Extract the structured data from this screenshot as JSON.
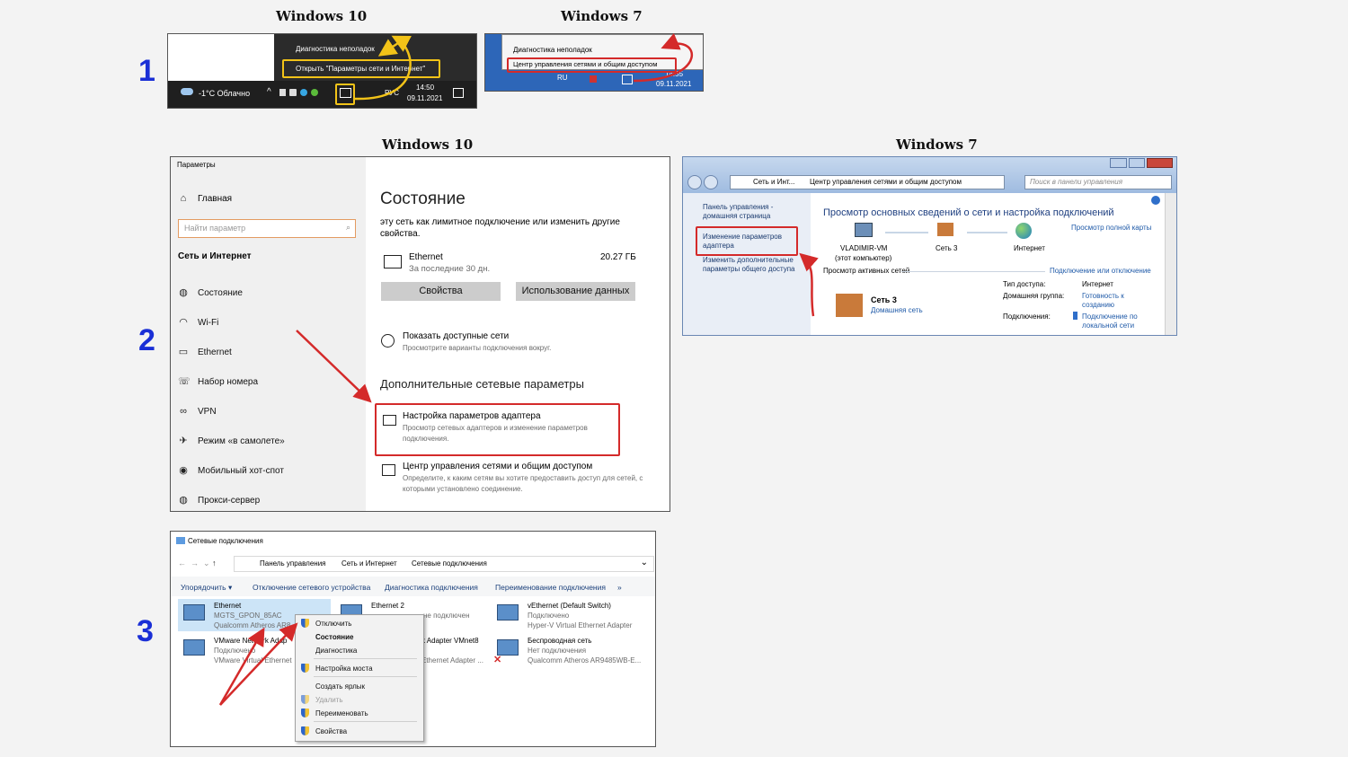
{
  "headings": {
    "row1_win10": "Windows 10",
    "row1_win7": "Windows 7",
    "row2_win10": "Windows 10",
    "row2_win7": "Windows 7"
  },
  "steps": [
    "1",
    "2",
    "3"
  ],
  "colors": {
    "highlight_red": "#d42a2a",
    "highlight_yellow": "#f2c318",
    "step_blue": "#1a2fd6"
  },
  "tray10": {
    "menu_item_1": "Диагностика неполадок",
    "menu_item_2": "Открыть \"Параметры сети и Интернет\"",
    "weather": "-1°C Облачно",
    "lang": "РУС",
    "time": "14:50",
    "date": "09.11.2021"
  },
  "tray7": {
    "menu_item_1": "Диагностика неполадок",
    "menu_item_2": "Центр управления сетями и общим доступом",
    "lang": "RU",
    "time": "14:55",
    "date": "09.11.2021"
  },
  "settings10": {
    "window_title": "Параметры",
    "home": "Главная",
    "search_placeholder": "Найти параметр",
    "section": "Сеть и Интернет",
    "nav": [
      "Состояние",
      "Wi-Fi",
      "Ethernet",
      "Набор номера",
      "VPN",
      "Режим «в самолете»",
      "Мобильный хот-спот",
      "Прокси-сервер"
    ],
    "page_title": "Состояние",
    "intro": "эту сеть как лимитное подключение или изменить другие свойства.",
    "adapter_name": "Ethernet",
    "adapter_sub": "За последние 30 дн.",
    "adapter_usage": "20.27 ГБ",
    "btn_props": "Свойства",
    "btn_usage": "Использование данных",
    "show_networks": "Показать доступные сети",
    "show_networks_sub": "Просмотрите варианты подключения вокруг.",
    "advanced_title": "Дополнительные сетевые параметры",
    "adapter_settings": "Настройка параметров адаптера",
    "adapter_settings_sub": "Просмотр сетевых адаптеров и изменение параметров подключения.",
    "net_center": "Центр управления сетями и общим доступом",
    "net_center_sub": "Определите, к каким сетям вы хотите предоставить доступ для сетей, с которыми установлено соединение."
  },
  "control7": {
    "breadcrumb": [
      "Сеть и Инт...",
      "Центр управления сетями и общим доступом"
    ],
    "search_placeholder": "Поиск в панели управления",
    "left_home": "Панель управления - домашняя страница",
    "left_adapter": "Изменение параметров адаптера",
    "left_sharing": "Изменить дополнительные параметры общего доступа",
    "title": "Просмотр основных сведений о сети и настройка подключений",
    "full_map": "Просмотр полной карты",
    "node_pc": "VLADIMIR-VM",
    "node_pc_sub": "(этот компьютер)",
    "node_net": "Сеть 3",
    "node_inet": "Интернет",
    "active_title": "Просмотр активных сетей",
    "connect_link": "Подключение или отключение",
    "net_name": "Сеть 3",
    "net_type": "Домашняя сеть",
    "access_label": "Тип доступа:",
    "access_value": "Интернет",
    "group_label": "Домашняя группа:",
    "group_value": "Готовность к созданию",
    "conn_label": "Подключения:",
    "conn_value": "Подключение по локальной сети"
  },
  "netconn": {
    "window_title": "Сетевые подключения",
    "breadcrumb": [
      "Панель управления",
      "Сеть и Интернет",
      "Сетевые подключения"
    ],
    "toolbar": [
      "Упорядочить ▾",
      "Отключение сетевого устройства",
      "Диагностика подключения",
      "Переименование подключения",
      "»"
    ],
    "adapters": [
      {
        "name": "Ethernet",
        "status": "MGTS_GPON_85AC",
        "device": "Qualcomm Atheros AR8"
      },
      {
        "name": "Ethernet 2",
        "status": "не подключен",
        "device": ""
      },
      {
        "name": "vEthernet (Default Switch)",
        "status": "Подключено",
        "device": "Hyper-V Virtual Ethernet Adapter"
      },
      {
        "name": "VMware Network Adap",
        "status": "Подключено",
        "device": "VMware Virtual Ethernet"
      },
      {
        "name": "k Adapter VMnet8",
        "status": "",
        "device": "Ethernet Adapter ..."
      },
      {
        "name": "Беспроводная сеть",
        "status": "Нет подключения",
        "device": "Qualcomm Atheros AR9485WB-E..."
      }
    ],
    "context_menu": [
      "Отключить",
      "Состояние",
      "Диагностика",
      "Настройка моста",
      "Создать ярлык",
      "Удалить",
      "Переименовать",
      "Свойства"
    ]
  }
}
